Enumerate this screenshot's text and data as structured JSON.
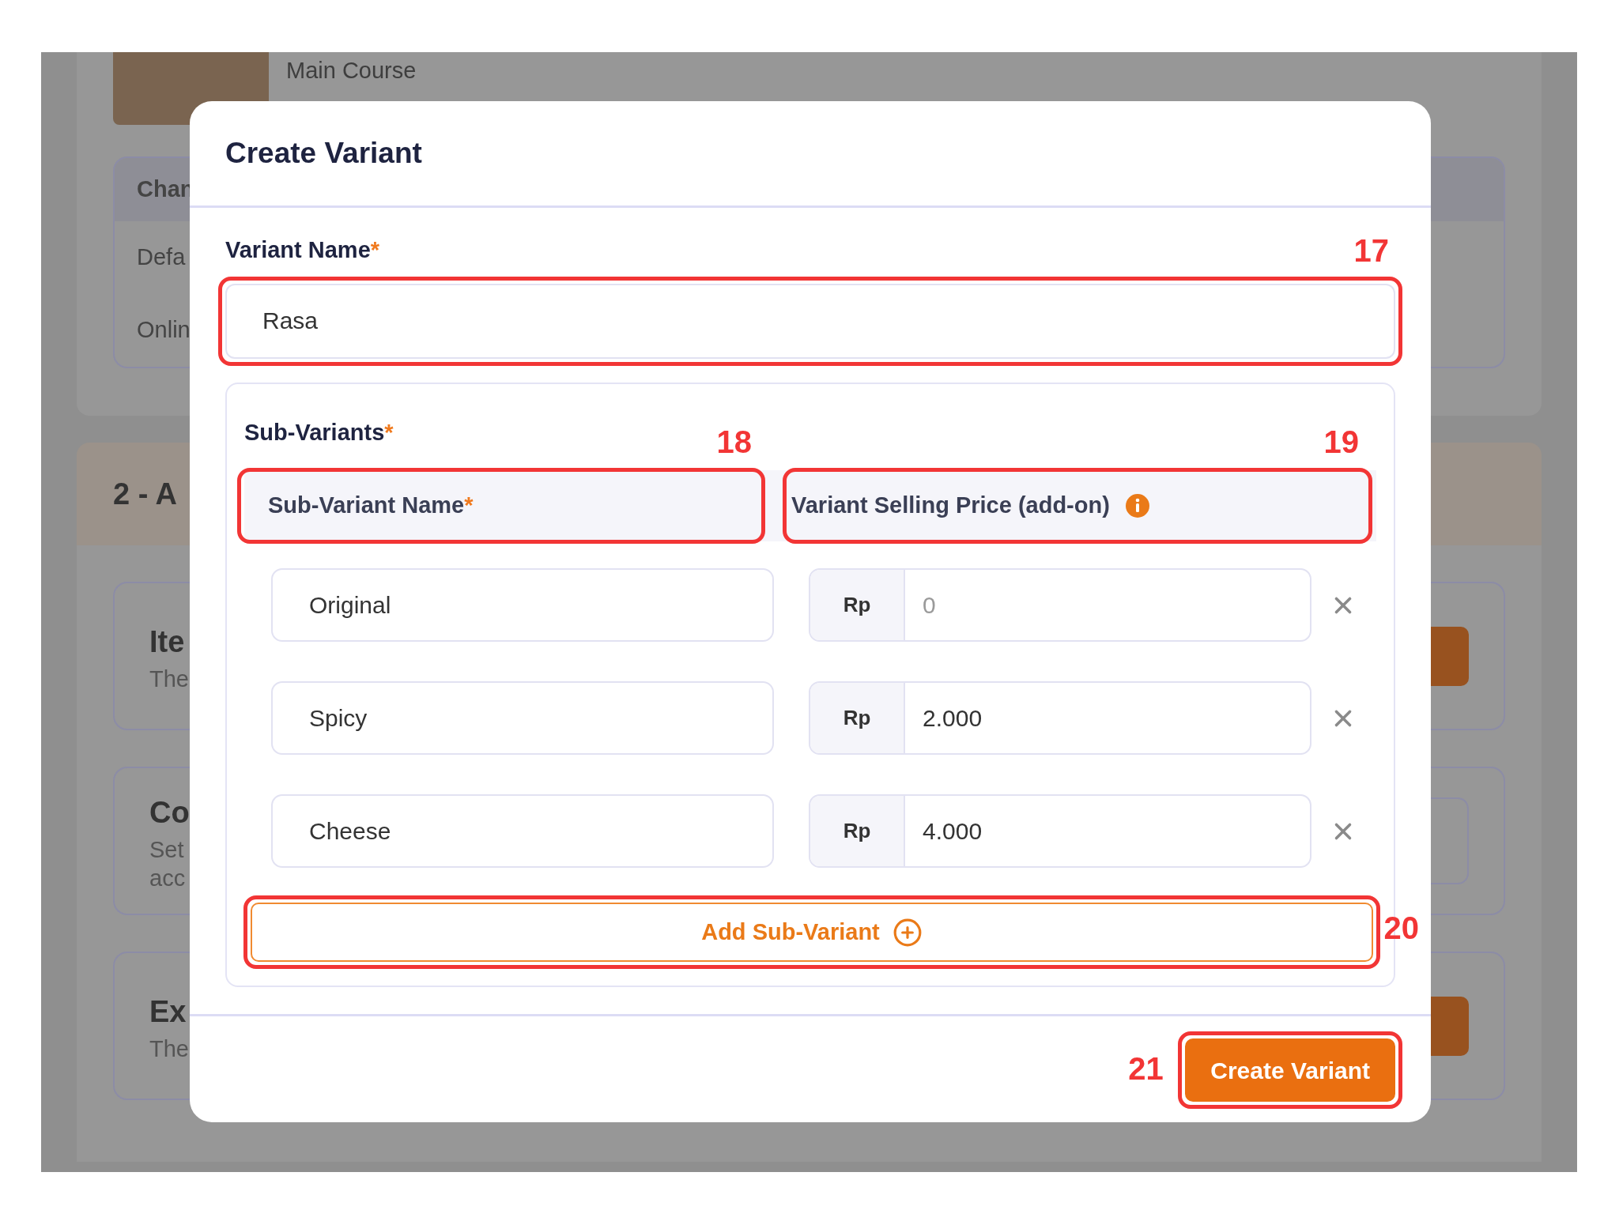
{
  "background": {
    "dish_category": "Main Course",
    "channel_header": "Chan",
    "channel_rows": [
      "Defa",
      "Onlin"
    ],
    "section_title": "2 - A",
    "cards": [
      {
        "title": "Ite",
        "description_lines": [
          "The"
        ],
        "kind": "button"
      },
      {
        "title": "Co",
        "description_lines": [
          "Set",
          "acc"
        ],
        "kind": "field"
      },
      {
        "title": "Ex",
        "description_lines": [
          "The"
        ],
        "kind": "button"
      }
    ]
  },
  "modal": {
    "title": "Create Variant",
    "variant_name": {
      "label": "Variant Name",
      "required_mark": "*",
      "value": "Rasa",
      "annotation": "17"
    },
    "sub_variants": {
      "label": "Sub-Variants",
      "required_mark": "*",
      "columns": [
        {
          "label": "Sub-Variant Name",
          "required_mark": "*",
          "annotation": "18"
        },
        {
          "label": "Variant Selling Price (add-on)",
          "info": true,
          "annotation": "19"
        }
      ],
      "rows": [
        {
          "name": "Original",
          "currency": "Rp",
          "placeholder": "0"
        },
        {
          "name": "Spicy",
          "currency": "Rp",
          "price": "2.000"
        },
        {
          "name": "Cheese",
          "currency": "Rp",
          "price": "4.000"
        }
      ],
      "add_button": {
        "label": "Add Sub-Variant",
        "annotation": "20"
      }
    },
    "submit": {
      "label": "Create Variant",
      "annotation": "21"
    }
  }
}
